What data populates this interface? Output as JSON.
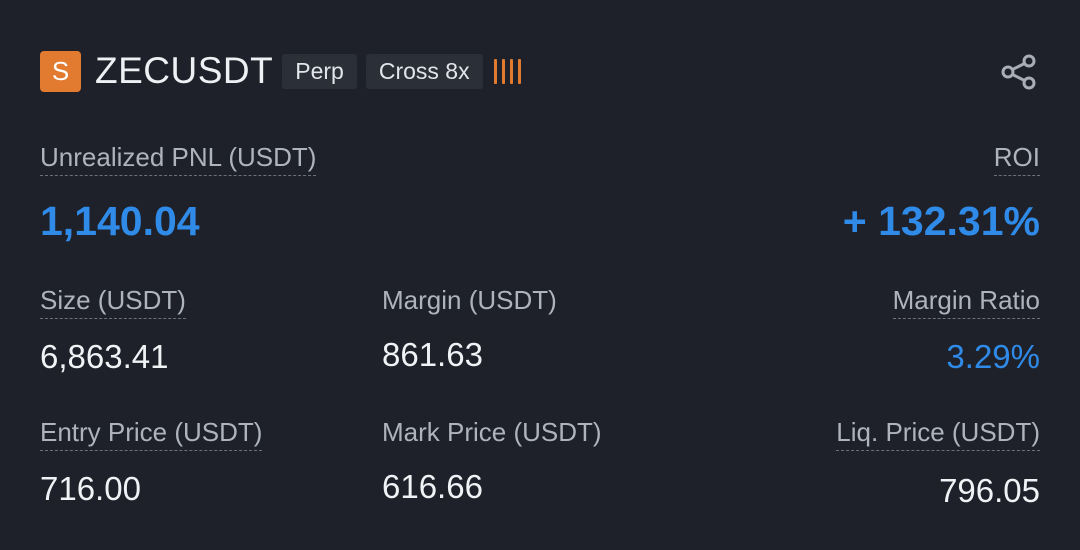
{
  "header": {
    "symbol_badge": "S",
    "symbol": "ZECUSDT",
    "tags": [
      "Perp",
      "Cross 8x"
    ],
    "risk_bars": 4,
    "share_icon": "share-icon"
  },
  "pnl": {
    "label": "Unrealized PNL (USDT)",
    "value": "1,140.04",
    "roi_label": "ROI",
    "roi_value": "+ 132.31%"
  },
  "stats": {
    "size_label": "Size (USDT)",
    "size_value": "6,863.41",
    "margin_label": "Margin (USDT)",
    "margin_value": "861.63",
    "margin_ratio_label": "Margin Ratio",
    "margin_ratio_value": "3.29%",
    "entry_label": "Entry Price (USDT)",
    "entry_value": "716.00",
    "mark_label": "Mark Price (USDT)",
    "mark_value": "616.66",
    "liq_label": "Liq. Price (USDT)",
    "liq_value": "796.05"
  },
  "colors": {
    "background": "#1e2129",
    "accent_blue": "#2f8ae8",
    "brand_orange": "#e27b2f"
  }
}
